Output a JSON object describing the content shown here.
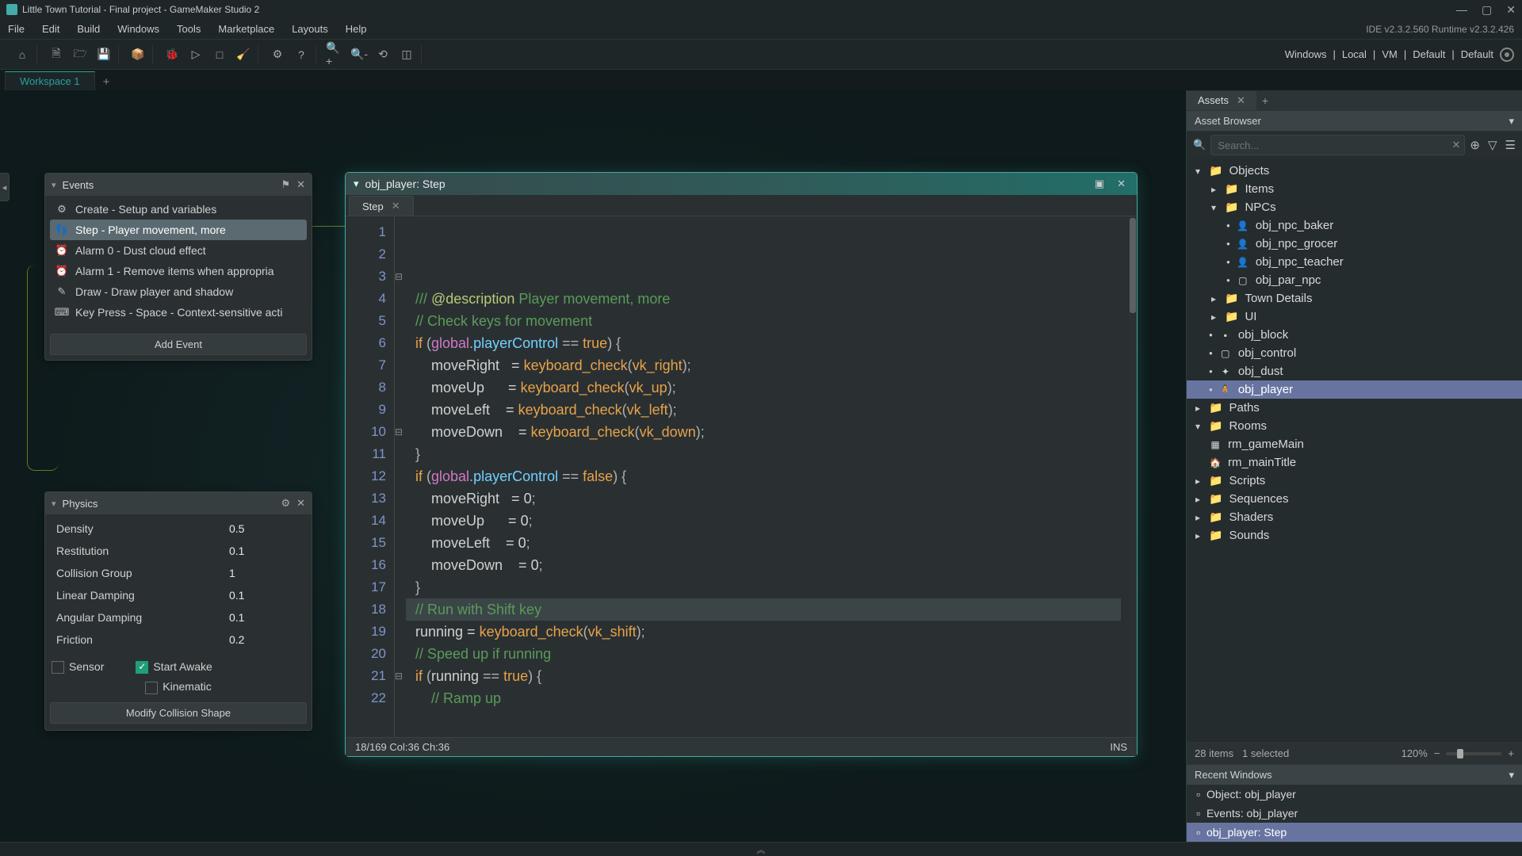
{
  "window": {
    "title": "Little Town Tutorial - Final project - GameMaker Studio 2"
  },
  "menu": {
    "items": [
      "File",
      "Edit",
      "Build",
      "Windows",
      "Tools",
      "Marketplace",
      "Layouts",
      "Help"
    ],
    "version": "IDE v2.3.2.560  Runtime v2.3.2.426"
  },
  "toolbar_right": {
    "windows": "Windows",
    "local": "Local",
    "vm": "VM",
    "default1": "Default",
    "default2": "Default"
  },
  "workspace": {
    "tab": "Workspace 1"
  },
  "events": {
    "title": "Events",
    "list": [
      {
        "label": "Create - Setup and variables"
      },
      {
        "label": "Step - Player movement, more",
        "selected": true
      },
      {
        "label": "Alarm 0 - Dust cloud effect"
      },
      {
        "label": "Alarm 1 - Remove items when appropria"
      },
      {
        "label": "Draw - Draw player and shadow"
      },
      {
        "label": "Key Press - Space - Context-sensitive acti"
      }
    ],
    "add": "Add Event"
  },
  "physics": {
    "title": "Physics",
    "rows": [
      {
        "label": "Density",
        "value": "0.5"
      },
      {
        "label": "Restitution",
        "value": "0.1"
      },
      {
        "label": "Collision Group",
        "value": "1"
      },
      {
        "label": "Linear Damping",
        "value": "0.1"
      },
      {
        "label": "Angular Damping",
        "value": "0.1"
      },
      {
        "label": "Friction",
        "value": "0.2"
      }
    ],
    "sensor": "Sensor",
    "start_awake": "Start Awake",
    "kinematic": "Kinematic",
    "modify": "Modify Collision Shape"
  },
  "editor": {
    "title": "obj_player: Step",
    "tab": "Step",
    "status_left": "18/169 Col:36 Ch:36",
    "status_right": "INS"
  },
  "code": {
    "lines": [
      [
        {
          "c": "cm",
          "t": "/// "
        },
        {
          "c": "desc",
          "t": "@description"
        },
        {
          "c": "cm",
          "t": " Player movement, more"
        }
      ],
      [
        {
          "c": "cm",
          "t": "// Check keys for movement"
        }
      ],
      [
        {
          "c": "kw",
          "t": "if"
        },
        {
          "c": "punc",
          "t": " ("
        },
        {
          "c": "gl",
          "t": "global"
        },
        {
          "c": "punc",
          "t": "."
        },
        {
          "c": "var",
          "t": "playerControl"
        },
        {
          "c": "punc",
          "t": " == "
        },
        {
          "c": "kw",
          "t": "true"
        },
        {
          "c": "punc",
          "t": ") {"
        }
      ],
      [
        {
          "c": "id",
          "t": "    moveRight   = "
        },
        {
          "c": "fn",
          "t": "keyboard_check"
        },
        {
          "c": "punc",
          "t": "("
        },
        {
          "c": "const",
          "t": "vk_right"
        },
        {
          "c": "punc",
          "t": ");"
        }
      ],
      [
        {
          "c": "id",
          "t": "    moveUp      = "
        },
        {
          "c": "fn",
          "t": "keyboard_check"
        },
        {
          "c": "punc",
          "t": "("
        },
        {
          "c": "const",
          "t": "vk_up"
        },
        {
          "c": "punc",
          "t": ");"
        }
      ],
      [
        {
          "c": "id",
          "t": "    moveLeft    = "
        },
        {
          "c": "fn",
          "t": "keyboard_check"
        },
        {
          "c": "punc",
          "t": "("
        },
        {
          "c": "const",
          "t": "vk_left"
        },
        {
          "c": "punc",
          "t": ");"
        }
      ],
      [
        {
          "c": "id",
          "t": "    moveDown    = "
        },
        {
          "c": "fn",
          "t": "keyboard_check"
        },
        {
          "c": "punc",
          "t": "("
        },
        {
          "c": "const",
          "t": "vk_down"
        },
        {
          "c": "punc",
          "t": ");"
        }
      ],
      [
        {
          "c": "punc",
          "t": "}"
        }
      ],
      [
        {
          "c": "id",
          "t": ""
        }
      ],
      [
        {
          "c": "kw",
          "t": "if"
        },
        {
          "c": "punc",
          "t": " ("
        },
        {
          "c": "gl",
          "t": "global"
        },
        {
          "c": "punc",
          "t": "."
        },
        {
          "c": "var",
          "t": "playerControl"
        },
        {
          "c": "punc",
          "t": " == "
        },
        {
          "c": "kw",
          "t": "false"
        },
        {
          "c": "punc",
          "t": ") {"
        }
      ],
      [
        {
          "c": "id",
          "t": "    moveRight   = "
        },
        {
          "c": "num",
          "t": "0"
        },
        {
          "c": "punc",
          "t": ";"
        }
      ],
      [
        {
          "c": "id",
          "t": "    moveUp      = "
        },
        {
          "c": "num",
          "t": "0"
        },
        {
          "c": "punc",
          "t": ";"
        }
      ],
      [
        {
          "c": "id",
          "t": "    moveLeft    = "
        },
        {
          "c": "num",
          "t": "0"
        },
        {
          "c": "punc",
          "t": ";"
        }
      ],
      [
        {
          "c": "id",
          "t": "    moveDown    = "
        },
        {
          "c": "num",
          "t": "0"
        },
        {
          "c": "punc",
          "t": ";"
        }
      ],
      [
        {
          "c": "punc",
          "t": "}"
        }
      ],
      [
        {
          "c": "id",
          "t": ""
        }
      ],
      [
        {
          "c": "cm",
          "t": "// Run with Shift key"
        }
      ],
      [
        {
          "c": "id",
          "t": "running = "
        },
        {
          "c": "fn",
          "t": "keyboard_check"
        },
        {
          "c": "punc",
          "t": "("
        },
        {
          "c": "const",
          "t": "vk_shift"
        },
        {
          "c": "punc",
          "t": ");"
        }
      ],
      [
        {
          "c": "id",
          "t": ""
        }
      ],
      [
        {
          "c": "cm",
          "t": "// Speed up if running"
        }
      ],
      [
        {
          "c": "kw",
          "t": "if"
        },
        {
          "c": "punc",
          "t": " ("
        },
        {
          "c": "id",
          "t": "running"
        },
        {
          "c": "punc",
          "t": " == "
        },
        {
          "c": "kw",
          "t": "true"
        },
        {
          "c": "punc",
          "t": ") {"
        }
      ],
      [
        {
          "c": "cm",
          "t": "    // Ramp up"
        }
      ]
    ],
    "highlight_line_index": 17
  },
  "assets": {
    "tab": "Assets",
    "browser_label": "Asset Browser",
    "search_placeholder": "Search..."
  },
  "tree": [
    {
      "d": 0,
      "t": "folder",
      "open": true,
      "bullet": false,
      "label": "Objects"
    },
    {
      "d": 1,
      "t": "folder",
      "open": false,
      "bullet": false,
      "label": "Items"
    },
    {
      "d": 1,
      "t": "folder",
      "open": true,
      "bullet": false,
      "label": "NPCs"
    },
    {
      "d": 2,
      "t": "obj",
      "bullet": true,
      "icon": "npc",
      "label": "obj_npc_baker"
    },
    {
      "d": 2,
      "t": "obj",
      "bullet": true,
      "icon": "npc",
      "label": "obj_npc_grocer"
    },
    {
      "d": 2,
      "t": "obj",
      "bullet": true,
      "icon": "npc",
      "label": "obj_npc_teacher"
    },
    {
      "d": 2,
      "t": "obj",
      "bullet": true,
      "icon": "square",
      "label": "obj_par_npc"
    },
    {
      "d": 1,
      "t": "folder",
      "open": false,
      "bullet": false,
      "label": "Town Details"
    },
    {
      "d": 1,
      "t": "folder",
      "open": false,
      "bullet": false,
      "label": "UI"
    },
    {
      "d": 1,
      "t": "obj",
      "bullet": true,
      "icon": "block",
      "label": "obj_block"
    },
    {
      "d": 1,
      "t": "obj",
      "bullet": true,
      "icon": "square",
      "label": "obj_control"
    },
    {
      "d": 1,
      "t": "obj",
      "bullet": true,
      "icon": "dust",
      "label": "obj_dust"
    },
    {
      "d": 1,
      "t": "obj",
      "bullet": true,
      "icon": "player",
      "label": "obj_player",
      "sel": true
    },
    {
      "d": 0,
      "t": "folder",
      "open": false,
      "bullet": false,
      "label": "Paths"
    },
    {
      "d": 0,
      "t": "folder",
      "open": true,
      "bullet": false,
      "label": "Rooms"
    },
    {
      "d": 1,
      "t": "room",
      "icon": "room",
      "label": "rm_gameMain"
    },
    {
      "d": 1,
      "t": "room",
      "icon": "roomhome",
      "label": "rm_mainTitle"
    },
    {
      "d": 0,
      "t": "folder",
      "open": false,
      "bullet": false,
      "label": "Scripts"
    },
    {
      "d": 0,
      "t": "folder",
      "open": false,
      "bullet": false,
      "label": "Sequences"
    },
    {
      "d": 0,
      "t": "folder",
      "open": false,
      "bullet": false,
      "label": "Shaders"
    },
    {
      "d": 0,
      "t": "folder",
      "open": false,
      "bullet": false,
      "label": "Sounds"
    }
  ],
  "tree_footer": {
    "count": "28 items",
    "selected": "1 selected",
    "zoom": "120%"
  },
  "recent": {
    "title": "Recent Windows",
    "items": [
      {
        "label": "Object: obj_player"
      },
      {
        "label": "Events: obj_player"
      },
      {
        "label": "obj_player: Step",
        "sel": true
      }
    ]
  }
}
